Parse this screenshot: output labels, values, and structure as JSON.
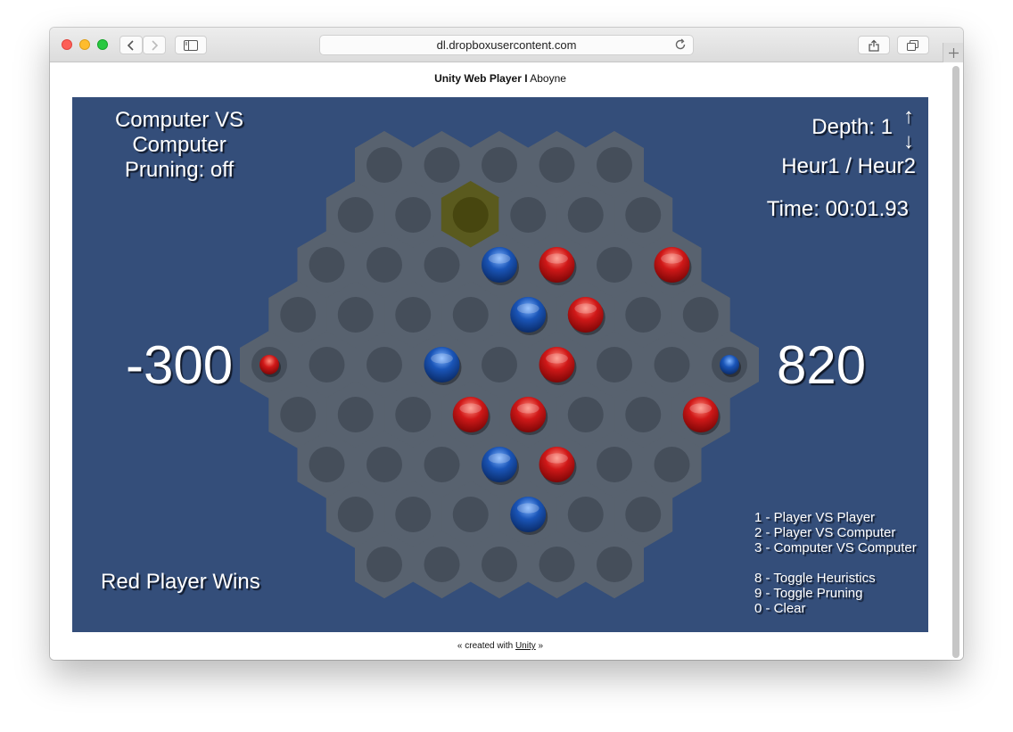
{
  "browser": {
    "url": "dl.dropboxusercontent.com"
  },
  "page": {
    "header_bold": "Unity Web Player I",
    "header_name": "Aboyne",
    "footer_prefix": "« created with",
    "footer_link": "Unity",
    "footer_suffix": "»"
  },
  "game": {
    "mode_line1": "Computer VS",
    "mode_line2": "Computer",
    "pruning": "Pruning: off",
    "depth": "Depth: 1",
    "arrow_up": "↑",
    "arrow_down": "↓",
    "heuristics": "Heur1 / Heur2",
    "time": "Time: 00:01.93",
    "score_left": "-300",
    "score_right": "820",
    "status": "Red Player Wins",
    "menu": [
      "1 - Player VS Player",
      "2 - Player VS Computer",
      "3 - Computer VS Computer",
      "8 - Toggle Heuristics",
      "9 - Toggle Pruning",
      "0 - Clear"
    ],
    "colors": {
      "background": "#344e7a",
      "board": "#58626f",
      "hole": "#454e5a",
      "highlight": "#5a5a1e",
      "red": "#d01818",
      "blue": "#1a55b8"
    },
    "board": {
      "row_lengths": [
        5,
        6,
        7,
        8,
        9,
        8,
        7,
        6,
        5
      ],
      "highlight": [
        1,
        2
      ],
      "pieces": [
        {
          "row": 2,
          "col": 3,
          "color": "blue",
          "size": "normal"
        },
        {
          "row": 2,
          "col": 4,
          "color": "red",
          "size": "normal"
        },
        {
          "row": 2,
          "col": 6,
          "color": "red",
          "size": "normal"
        },
        {
          "row": 3,
          "col": 4,
          "color": "blue",
          "size": "normal"
        },
        {
          "row": 3,
          "col": 5,
          "color": "red",
          "size": "normal"
        },
        {
          "row": 4,
          "col": 0,
          "color": "red",
          "size": "small"
        },
        {
          "row": 4,
          "col": 3,
          "color": "blue",
          "size": "normal"
        },
        {
          "row": 4,
          "col": 5,
          "color": "red",
          "size": "normal"
        },
        {
          "row": 4,
          "col": 8,
          "color": "blue",
          "size": "small"
        },
        {
          "row": 5,
          "col": 3,
          "color": "red",
          "size": "normal"
        },
        {
          "row": 5,
          "col": 4,
          "color": "red",
          "size": "normal"
        },
        {
          "row": 5,
          "col": 7,
          "color": "red",
          "size": "normal"
        },
        {
          "row": 6,
          "col": 3,
          "color": "blue",
          "size": "normal"
        },
        {
          "row": 6,
          "col": 4,
          "color": "red",
          "size": "normal"
        },
        {
          "row": 7,
          "col": 3,
          "color": "blue",
          "size": "normal"
        }
      ]
    }
  }
}
